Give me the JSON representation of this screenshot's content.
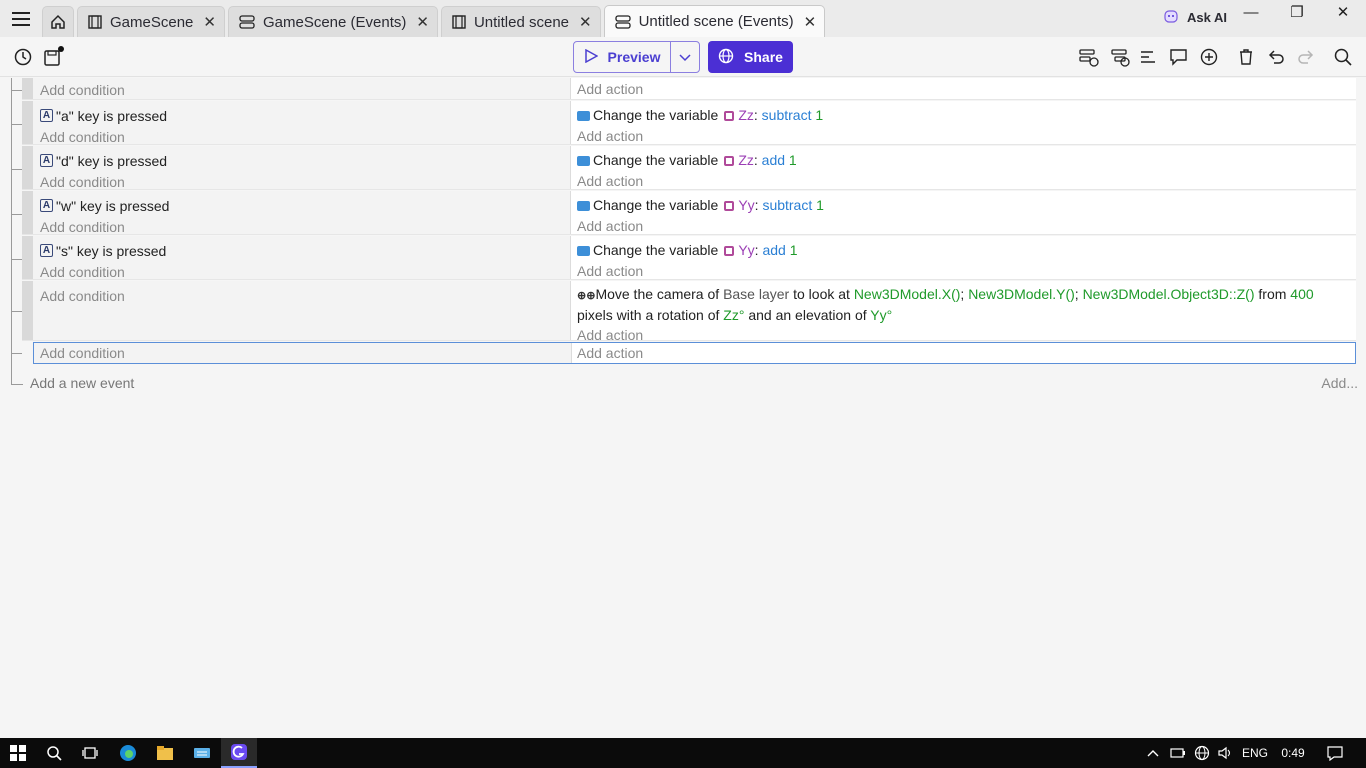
{
  "tabs": [
    {
      "label": "GameScene",
      "icon": "film-icon"
    },
    {
      "label": "GameScene (Events)",
      "icon": "events-icon"
    },
    {
      "label": "Untitled scene",
      "icon": "film-icon"
    },
    {
      "label": "Untitled scene (Events)",
      "icon": "events-icon",
      "active": true
    }
  ],
  "ask_ai": "Ask AI",
  "toolbar": {
    "preview_label": "Preview",
    "share_label": "Share"
  },
  "events": {
    "top_stub": {
      "condition": "Add condition",
      "action": "Add action"
    },
    "rows": [
      {
        "condition": "\"a\" key is pressed",
        "key": "A",
        "action_prefix": "Change the variable",
        "var": "Zz",
        "op": "subtract",
        "val": "1",
        "add_condition": "Add condition",
        "add_action": "Add action"
      },
      {
        "condition": "\"d\" key is pressed",
        "key": "A",
        "action_prefix": "Change the variable",
        "var": "Zz",
        "op": "add",
        "val": "1",
        "add_condition": "Add condition",
        "add_action": "Add action"
      },
      {
        "condition": "\"w\" key is pressed",
        "key": "A",
        "action_prefix": "Change the variable",
        "var": "Yy",
        "op": "subtract",
        "val": "1",
        "add_condition": "Add condition",
        "add_action": "Add action"
      },
      {
        "condition": "\"s\" key is pressed",
        "key": "A",
        "action_prefix": "Change the variable",
        "var": "Yy",
        "op": "add",
        "val": "1",
        "add_condition": "Add condition",
        "add_action": "Add action"
      }
    ],
    "camera": {
      "add_condition": "Add condition",
      "t1": "Move the camera of ",
      "layer": "Base layer",
      "t2": " to look at ",
      "x": "New3DModel.X()",
      "sep1": "; ",
      "y": "New3DModel.Y()",
      "sep2": "; ",
      "z": "New3DModel.Object3D::Z()",
      "t3": " from ",
      "dist": "400",
      "t4": "pixels with a rotation of ",
      "rot": "Zz°",
      "t5": " and an elevation of ",
      "elev": "Yy°",
      "add_action": "Add action"
    },
    "selected": {
      "condition": "Add condition",
      "action": "Add action"
    },
    "add_new_event": "Add a new event",
    "add_more": "Add..."
  },
  "taskbar": {
    "language": "ENG",
    "time": "0:49"
  }
}
